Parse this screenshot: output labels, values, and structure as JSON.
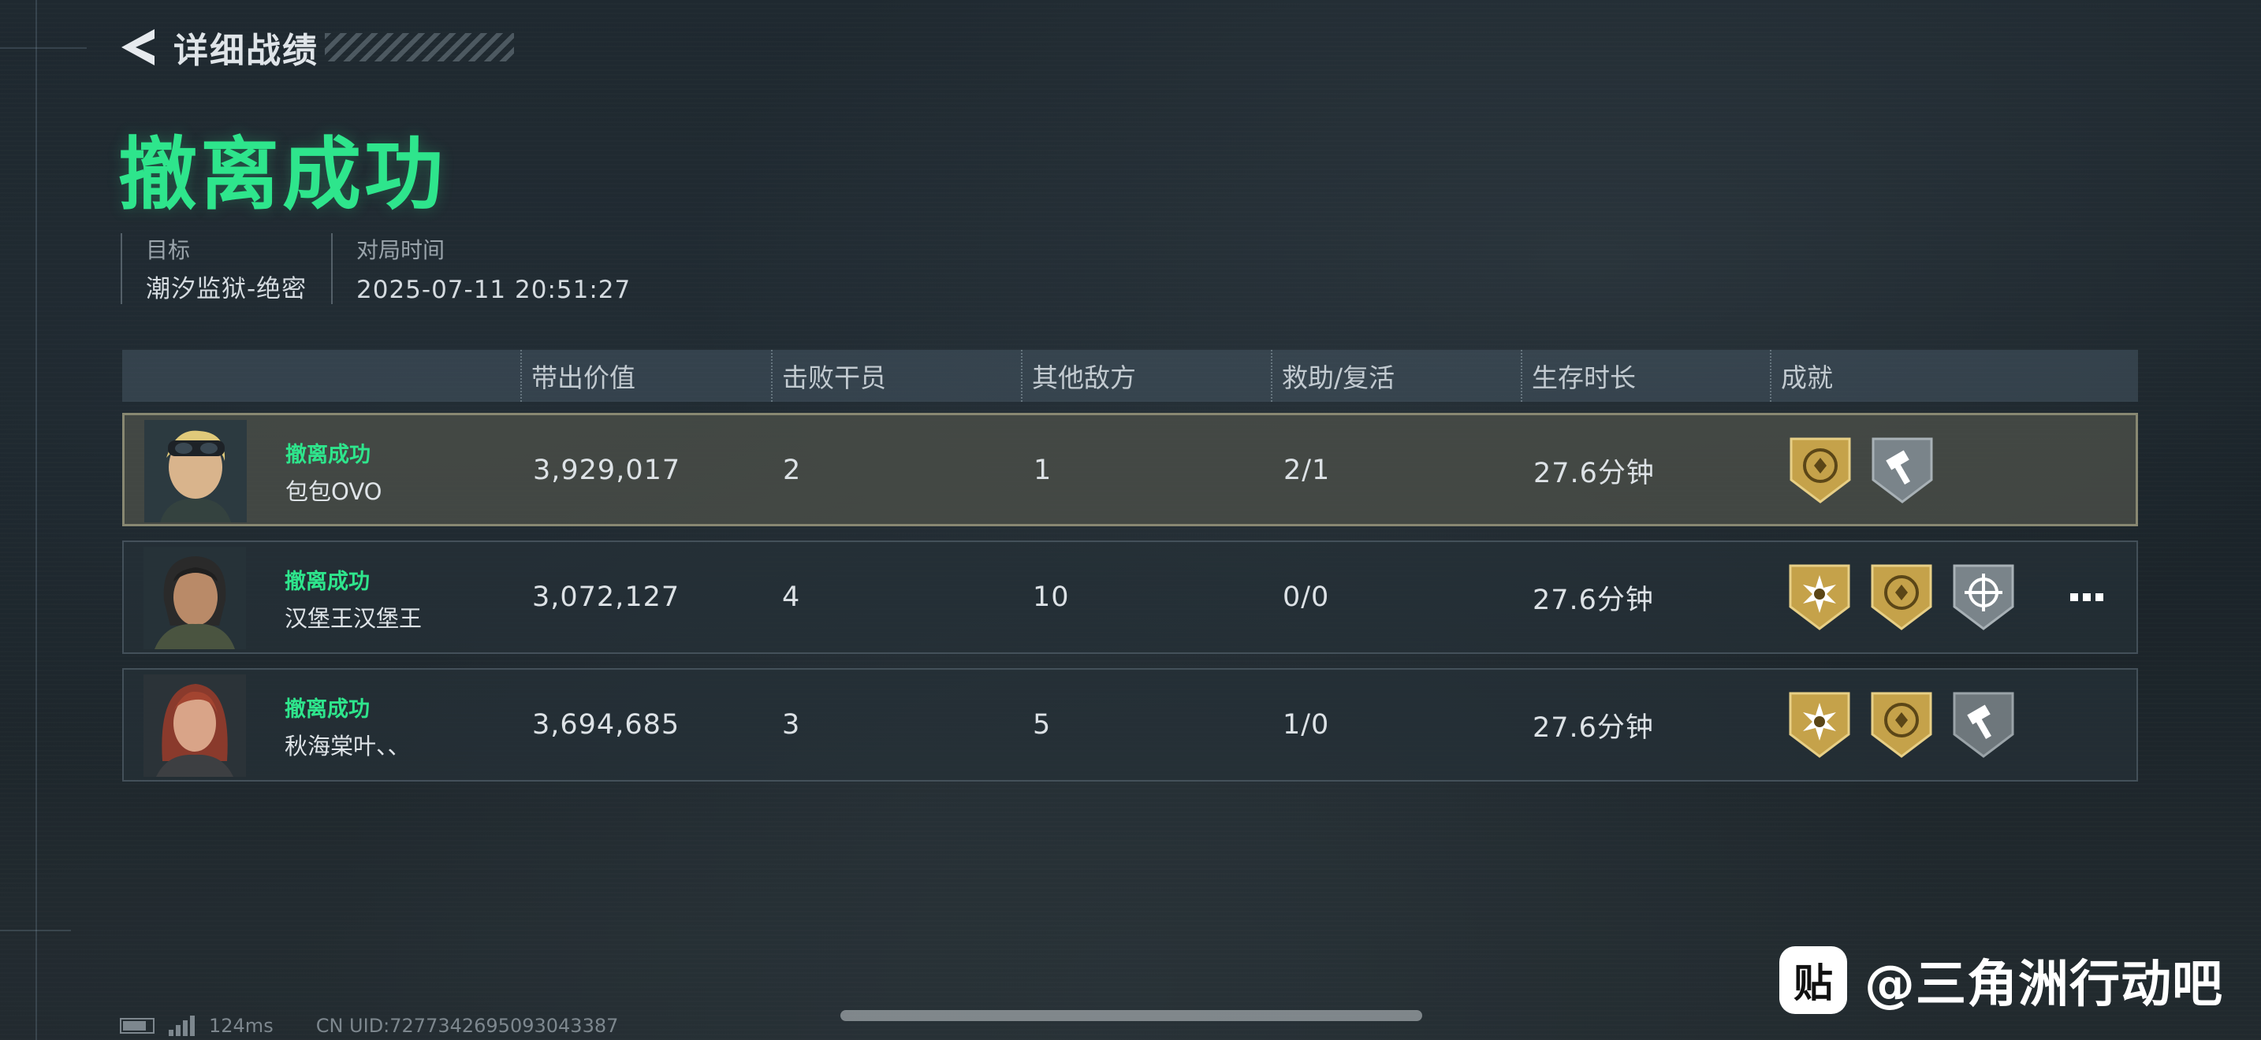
{
  "header": {
    "title": "详细战绩"
  },
  "result": {
    "title": "撤离成功"
  },
  "info": {
    "target_label": "目标",
    "target_value": "潮汐监狱-绝密",
    "time_label": "对局时间",
    "time_value": "2025-07-11 20:51:27"
  },
  "table": {
    "columns": [
      "带出价值",
      "击败干员",
      "其他敌方",
      "救助/复活",
      "生存时长",
      "成就"
    ],
    "rows": [
      {
        "status": "撤离成功",
        "name": "包包OVO",
        "value": "3,929,017",
        "kills": "2",
        "others": "1",
        "assist": "2/1",
        "duration": "27.6分钟",
        "badges": [
          "gold-emblem",
          "gray-hammer"
        ]
      },
      {
        "status": "撤离成功",
        "name": "汉堡王汉堡王",
        "value": "3,072,127",
        "kills": "4",
        "others": "10",
        "assist": "0/0",
        "duration": "27.6分钟",
        "badges": [
          "gold-starburst",
          "gold-emblem",
          "gray-crosshair"
        ]
      },
      {
        "status": "撤离成功",
        "name": "秋海棠叶、、",
        "value": "3,694,685",
        "kills": "3",
        "others": "5",
        "assist": "1/0",
        "duration": "27.6分钟",
        "badges": [
          "gold-starburst",
          "gold-emblem",
          "gray-hammer"
        ]
      }
    ]
  },
  "footer": {
    "ping": "124ms",
    "uid": "CN UID:7277342695093043387"
  },
  "watermark": {
    "logo": "贴",
    "text": "@三角洲行动吧"
  },
  "colors": {
    "accent": "#2ee58c",
    "background": "#1c252b",
    "badge_gold": "#c5a24a",
    "badge_gray": "#7a848a"
  }
}
